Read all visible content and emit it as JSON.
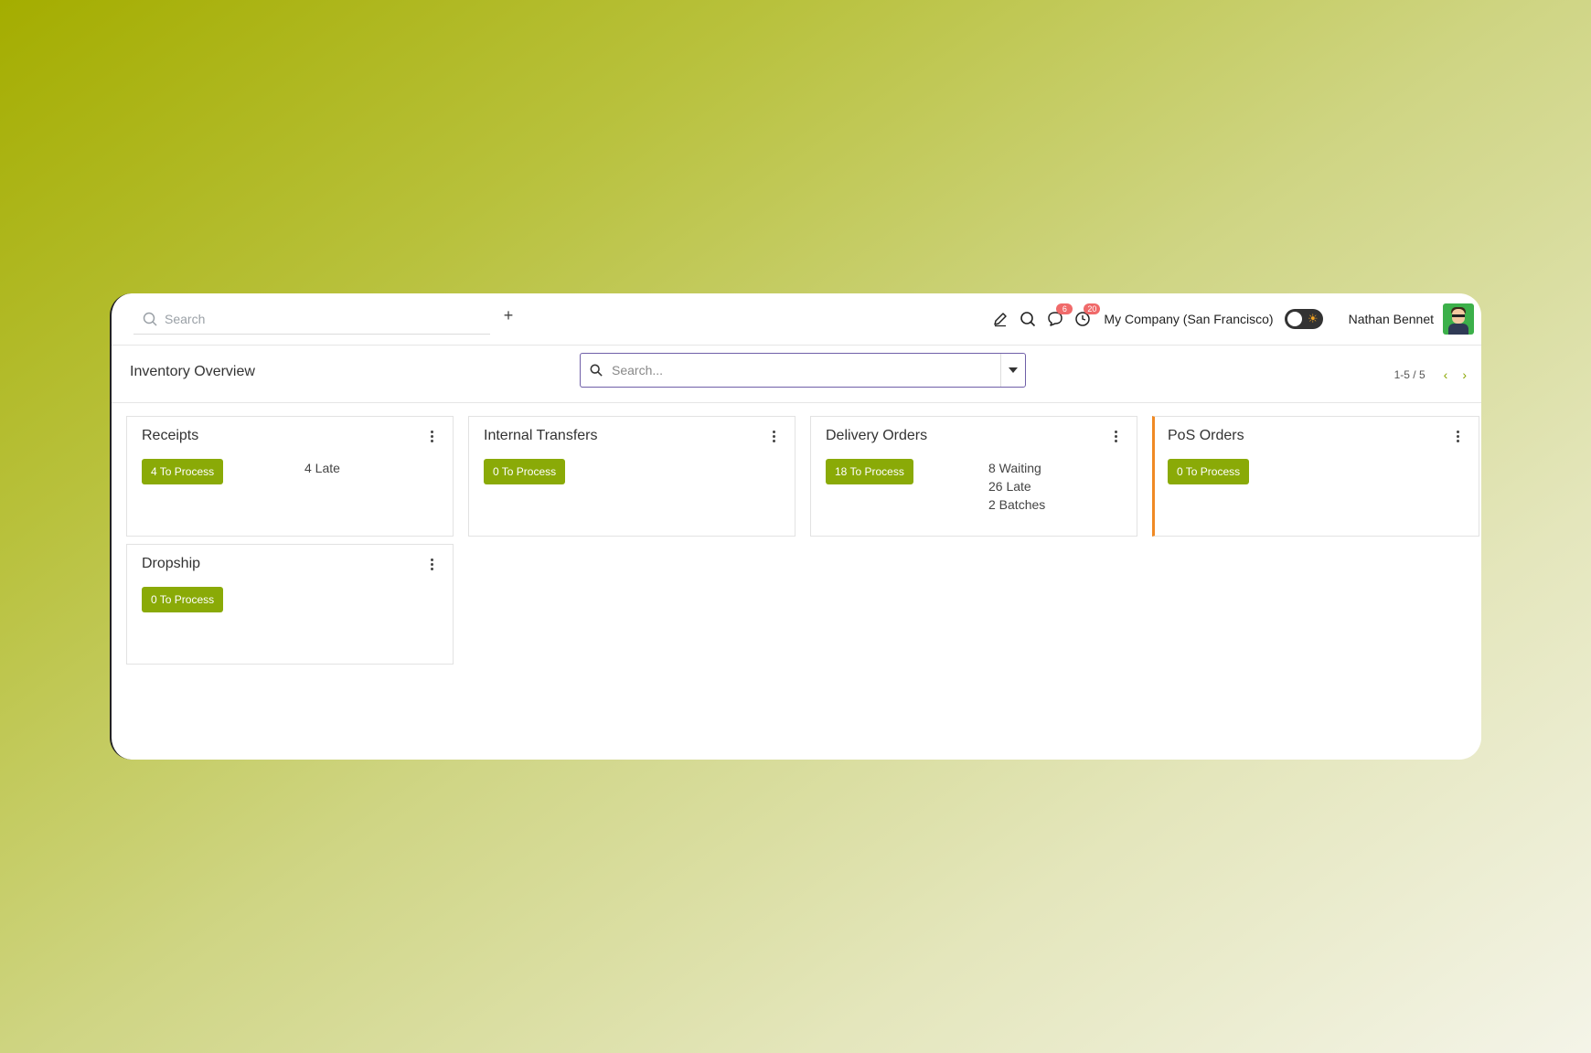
{
  "topbar": {
    "search_placeholder": "Search",
    "add_label": "+",
    "messages_count": "6",
    "activities_count": "20",
    "company": "My Company (San Francisco)",
    "user_name": "Nathan Bennet",
    "accent_color": "#8aaa07"
  },
  "control": {
    "page_title": "Inventory Overview",
    "search_placeholder": "Search...",
    "pager_text": "1-5 / 5"
  },
  "cards": [
    {
      "title": "Receipts",
      "button": "4 To Process",
      "stats": [
        "4 Late"
      ]
    },
    {
      "title": "Internal Transfers",
      "button": "0 To Process",
      "stats": []
    },
    {
      "title": "Delivery Orders",
      "button": "18 To Process",
      "stats": [
        "8 Waiting",
        "26 Late",
        "2 Batches"
      ]
    },
    {
      "title": "PoS Orders",
      "button": "0 To Process",
      "stats": [],
      "accent_color": "#f08a24"
    },
    {
      "title": "Dropship",
      "button": "0 To Process",
      "stats": []
    }
  ]
}
